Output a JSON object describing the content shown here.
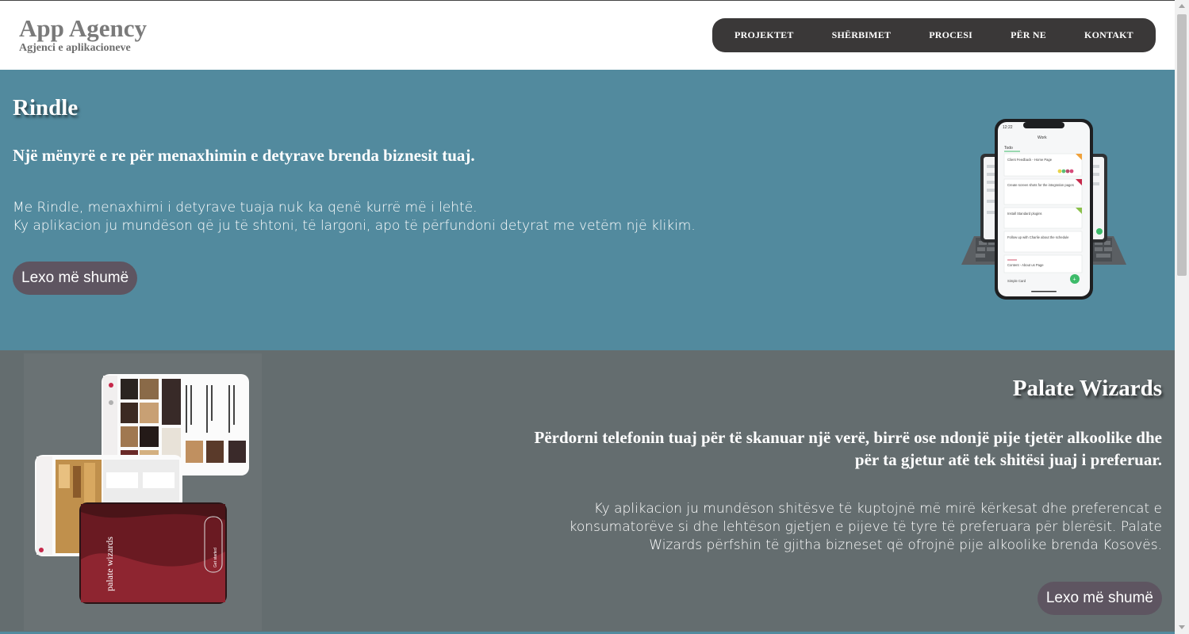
{
  "header": {
    "brand_title": "App Agency",
    "brand_subtitle": "Agjenci e aplikacioneve",
    "nav": [
      "PROJEKTET",
      "SHËRBIMET",
      "PROCESI",
      "PËR NE",
      "KONTAKT"
    ]
  },
  "sections": [
    {
      "title": "Rindle",
      "subtitle": "Një mënyrë e re për menaxhimin e detyrave brenda biznesit tuaj.",
      "desc_line1": "Me Rindle, menaxhimi i detyrave tuaja nuk ka qenë kurrë më i lehtë.",
      "desc_line2": "Ky aplikacion ju mundëson që ju të shtoni, të largoni, apo të përfundoni detyrat me vetëm një klikim.",
      "button": "Lexo më shumë",
      "phone": {
        "time": "12:22",
        "header": "Work",
        "list_title": "Todo",
        "cards": [
          "Client Feedback - Home Page",
          "Create screen shots for the integration pages",
          "Install Standard plugins",
          "Follow up with Charlie about the schedule",
          "Content - About us Page"
        ],
        "footer": "Simple Card"
      }
    },
    {
      "title": "Palate Wizards",
      "subtitle": "Përdorni telefonin tuaj për të skanuar një verë, birrë ose ndonjë pije tjetër alkoolike dhe për ta gjetur atë tek shitësi juaj i preferuar.",
      "desc": "Ky aplikacion ju mundëson shitësve të kuptojnë më mirë kërkesat dhe preferencat e konsumatorëve si dhe lehtëson gjetjen e pijeve të tyre të preferuara për blerësit. Palate Wizards përfshin të gjitha bizneset që ofrojnë pije alkoolike brenda Kosovës.",
      "button": "Lexo më shumë",
      "illustration": {
        "logo": "palate wizards",
        "get_started": "Get started"
      }
    }
  ],
  "colors": {
    "section1_bg": "#528a9e",
    "section2_bg": "#646d6f",
    "nav_bg": "#3a3838",
    "button_bg": "#5e5561"
  }
}
